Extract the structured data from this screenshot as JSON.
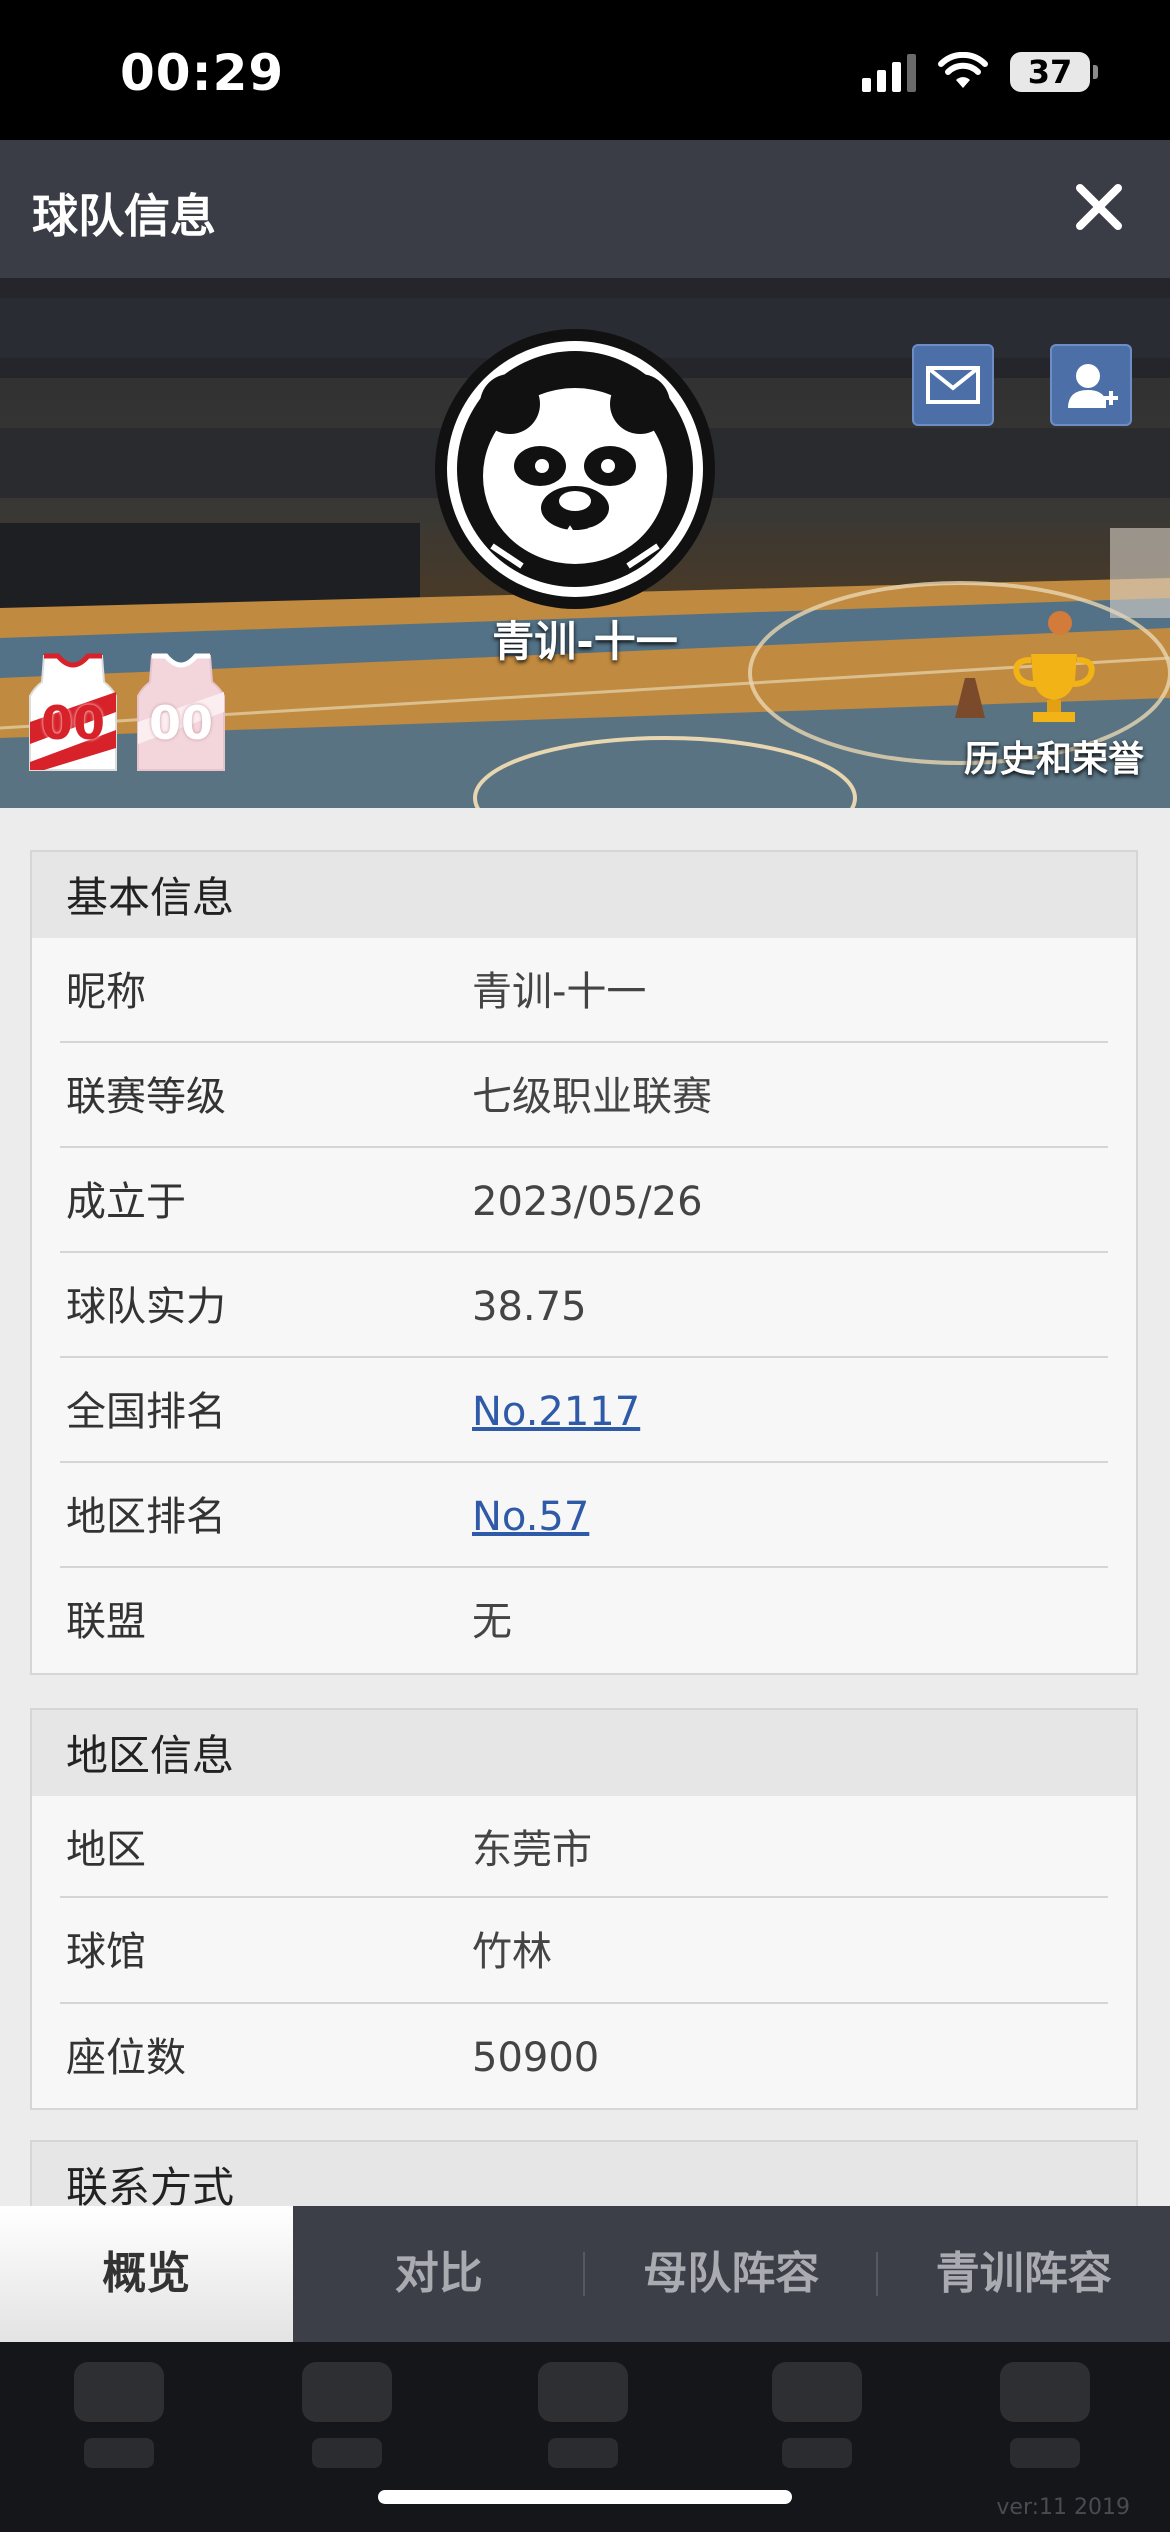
{
  "status": {
    "time": "00:29",
    "battery": "37"
  },
  "header": {
    "title": "球队信息"
  },
  "banner": {
    "team_name": "青训-十一",
    "honor_label": "历史和荣誉",
    "jersey_home_number": "00",
    "jersey_away_number": "00"
  },
  "basic": {
    "title": "基本信息",
    "rows": [
      {
        "label": "昵称",
        "value": "青训-十一"
      },
      {
        "label": "联赛等级",
        "value": "七级职业联赛"
      },
      {
        "label": "成立于",
        "value": "2023/05/26"
      },
      {
        "label": "球队实力",
        "value": "38.75"
      },
      {
        "label": "全国排名",
        "value": "No.2117"
      },
      {
        "label": "地区排名",
        "value": "No.57"
      },
      {
        "label": "联盟",
        "value": "无"
      }
    ]
  },
  "region": {
    "title": "地区信息",
    "rows": [
      {
        "label": "地区",
        "value": "东莞市"
      },
      {
        "label": "球馆",
        "value": "竹林"
      },
      {
        "label": "座位数",
        "value": "50900"
      }
    ]
  },
  "contact": {
    "title": "联系方式"
  },
  "tabs": [
    {
      "label": "概览"
    },
    {
      "label": "对比"
    },
    {
      "label": "母队阵容"
    },
    {
      "label": "青训阵容"
    }
  ],
  "footer": {
    "version": "ver:11  2019"
  },
  "colors": {
    "header_bg": "#3a3d46",
    "link": "#2f5aa8",
    "button_blue": "#4d6fa8",
    "tab_active_bg": "#ffffff"
  }
}
